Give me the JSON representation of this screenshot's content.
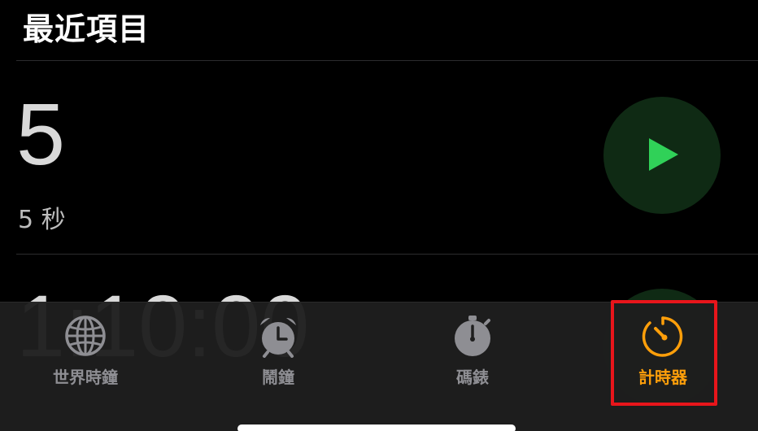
{
  "header": {
    "title": "最近項目"
  },
  "recent_timers": [
    {
      "duration_display": "5",
      "label": "5 秒"
    },
    {
      "duration_display": "1:10:00",
      "label": ""
    }
  ],
  "tab_bar": {
    "tabs": [
      {
        "label": "世界時鐘",
        "icon": "globe-icon",
        "active": false
      },
      {
        "label": "鬧鐘",
        "icon": "alarm-clock-icon",
        "active": false
      },
      {
        "label": "碼錶",
        "icon": "stopwatch-icon",
        "active": false
      },
      {
        "label": "計時器",
        "icon": "timer-icon",
        "active": true
      }
    ]
  },
  "colors": {
    "active_tab": "#ff9f0a",
    "inactive_tab": "#8e8e93",
    "play_green": "#30d158",
    "play_bg": "#0f2a14",
    "highlight": "#e8151b"
  }
}
